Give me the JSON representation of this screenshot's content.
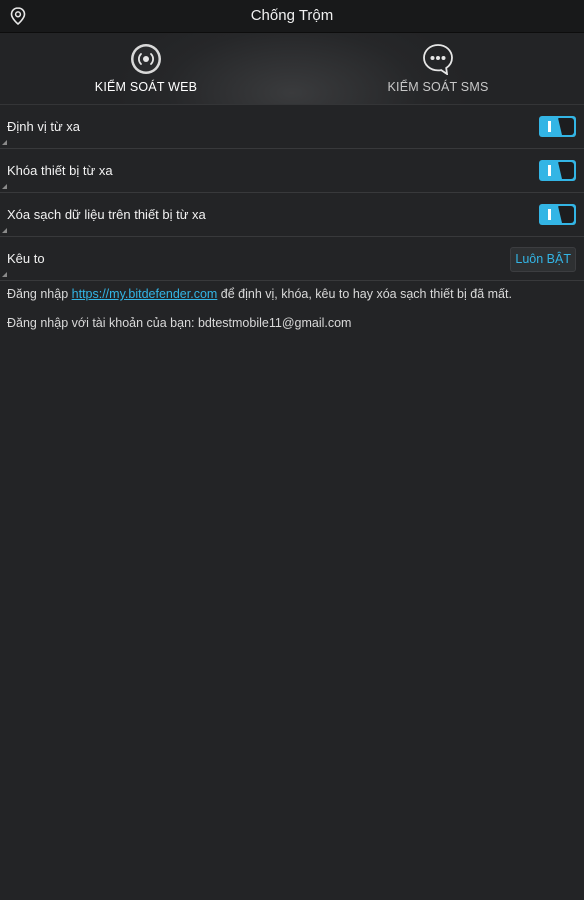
{
  "header": {
    "title": "Chống Trộm",
    "app_icon": "location-pin-icon"
  },
  "tabs": [
    {
      "label": "KIỂM SOÁT WEB",
      "icon": "broadcast-icon",
      "selected": true
    },
    {
      "label": "KIỂM SOÁT SMS",
      "icon": "chat-bubble-icon",
      "selected": false
    }
  ],
  "settings": [
    {
      "label": "Định vị từ xa",
      "control": "toggle",
      "on": true
    },
    {
      "label": "Khóa thiết bị từ xa",
      "control": "toggle",
      "on": true
    },
    {
      "label": "Xóa sạch dữ liệu trên thiết bị từ xa",
      "control": "toggle",
      "on": true
    },
    {
      "label": "Kêu to",
      "control": "button",
      "value": "Luôn BẬT"
    }
  ],
  "info": {
    "line1_prefix": "Đăng nhập ",
    "line1_link": "https://my.bitdefender.com",
    "line1_suffix": " để định vị, khóa, kêu to hay xóa sạch thiết bị đã mất.",
    "line2": "Đăng nhập với tài khoản của bạn: bdtestmobile11@gmail.com"
  },
  "colors": {
    "accent": "#33b5e5",
    "background": "#232426",
    "topbar": "#18191a"
  }
}
